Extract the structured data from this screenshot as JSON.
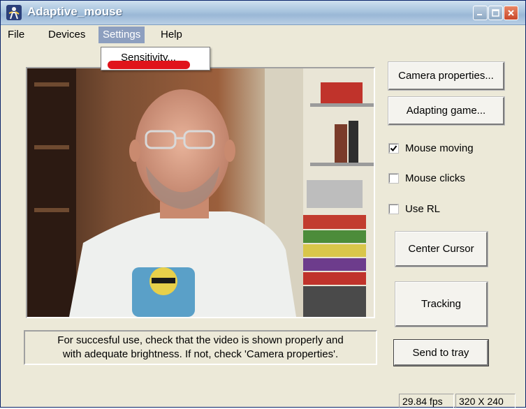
{
  "window": {
    "title": "Adaptive_mouse"
  },
  "menu": {
    "items": [
      {
        "label": "File"
      },
      {
        "label": "Devices"
      },
      {
        "label": "Settings"
      },
      {
        "label": "Help"
      }
    ],
    "open_menu": "Settings",
    "dropdown_items": [
      {
        "label": "Sensitivity..."
      }
    ]
  },
  "buttons": {
    "camera_properties": "Camera properties...",
    "adapting_game": "Adapting game...",
    "center_cursor": "Center Cursor",
    "tracking": "Tracking",
    "send_to_tray": "Send to tray"
  },
  "checkboxes": [
    {
      "label": "Mouse moving",
      "checked": true
    },
    {
      "label": "Mouse clicks",
      "checked": false
    },
    {
      "label": "Use RL",
      "checked": false
    }
  ],
  "message": {
    "line1": "For succesful use, check that the video is shown properly and",
    "line2": "with adequate brightness. If not, check 'Camera properties'."
  },
  "status": {
    "fps": "29.84 fps",
    "resolution": "320 X 240"
  },
  "colors": {
    "highlight_mark": "#e0131b",
    "menu_active": "#8d9fbf"
  }
}
